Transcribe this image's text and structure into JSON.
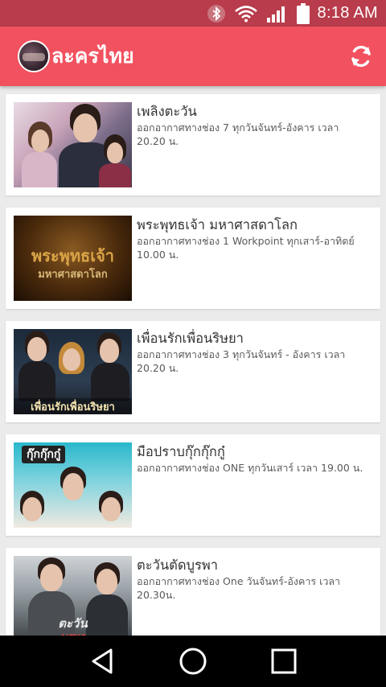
{
  "status_bar": {
    "time": "8:18 AM",
    "icons": [
      "bluetooth-icon",
      "wifi-icon",
      "signal-icon",
      "battery-icon"
    ]
  },
  "app_bar": {
    "title": "ละครไทย",
    "refresh_icon": "refresh-icon",
    "color": "#f2515f",
    "status_color": "#b83c4b"
  },
  "dramas": [
    {
      "title": "เพลิงตะวัน",
      "desc": "ออกอากาศทางช่อง 7 ทุกวันจันทร์-อังคาร เวลา 20.20 น."
    },
    {
      "title": "พระพุทธเจ้า มหาศาสดาโลก",
      "desc": "ออกอากาศทางช่อง 1 Workpoint ทุกเสาร์-อาทิตย์ 10.00 น.",
      "thumb_text_1": "พระพุทธเจ้า",
      "thumb_text_2": "มหาศาสดาโลก"
    },
    {
      "title": "เพื่อนรักเพื่อนริษยา",
      "desc": "ออกอากาศทางช่อง 3 ทุกวันจันทร์ - อังคาร เวลา 20.20 น.",
      "thumb_text_1": "เพื่อนรักเพื่อนริษยา"
    },
    {
      "title": "มือปราบกุ๊กกุ๊กกู๋",
      "desc": "ออกอากาศทางช่อง ONE ทุกวันเสาร์ เวลา 19.00 น.",
      "thumb_text_1": "กุ๊กกุ๊กกู๋"
    },
    {
      "title": "ตะวันตัดบูรพา",
      "desc": "ออกอากาศทางช่อง One วันจันทร์-อังคาร เวลา 20.30น.",
      "thumb_text_1": "ตะวัน",
      "thumb_text_2": "บูรพา"
    }
  ],
  "nav_bar": {
    "buttons": [
      "back-icon",
      "home-icon",
      "recents-icon"
    ]
  }
}
